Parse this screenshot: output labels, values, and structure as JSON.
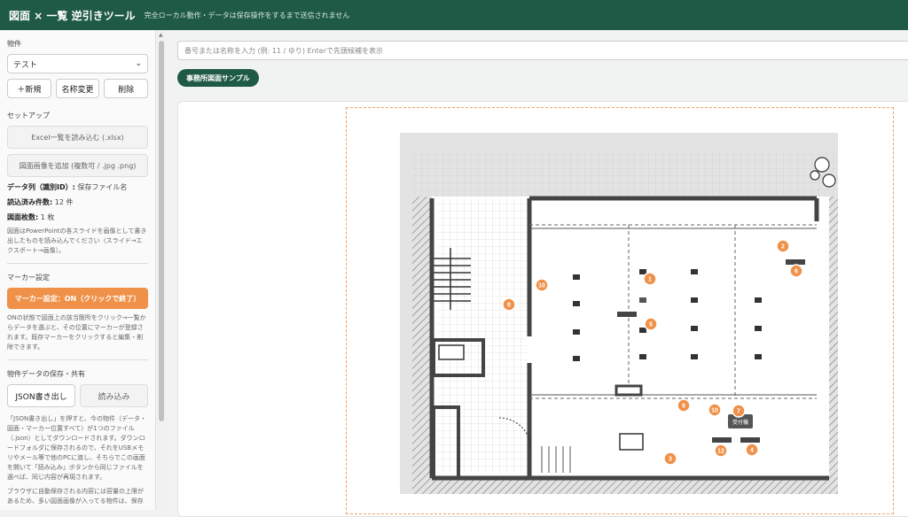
{
  "header": {
    "title": "図面 × 一覧 逆引きツール",
    "subtitle": "完全ローカル動作・データは保存操作をするまで送信されません"
  },
  "sidebar": {
    "property_label": "物件",
    "property_select": "テスト",
    "new_button": "＋新規",
    "rename_button": "名称変更",
    "delete_button": "削除",
    "setup_label": "セットアップ",
    "excel_button": "Excel一覧を読み込む (.xlsx)",
    "image_button": "図面画像を追加 (複数可 / .jpg .png)",
    "data_col_label": "データ列（識別ID）:",
    "data_col_value": "保存ファイル名",
    "loaded_label": "読込済み件数:",
    "loaded_value": "12 件",
    "drawings_label": "図面枚数:",
    "drawings_value": "1 枚",
    "drawings_note": "図面はPowerPointの各スライドを画像として書き出したものを読み込んでください（スライド→エクスポート→画像）。",
    "marker_label": "マーカー設定",
    "marker_button": "マーカー設定：ON（クリックで終了）",
    "marker_note": "ONの状態で図面上の該当箇所をクリック→一覧からデータを選ぶと、その位置にマーカーが登録されます。既存マーカーをクリックすると編集・削除できます。",
    "share_label": "物件データの保存・共有",
    "json_export_button": "JSON書き出し",
    "import_button": "読み込み",
    "share_note": "「JSON書き出し」を押すと、今の物件（データ・図面・マーカー位置すべて）が1つのファイル（.json）としてダウンロードされます。ダウンロードフォルダに保存されるので、それをUSBメモリやメール等で他のPCに渡し、そちらでこの画面を開いて「読み込み」ボタンから同じファイルを選べば、同じ内容が再現されます。",
    "storage_note": "ブラウザに自動保存される内容には容量の上限があるため、多い図面画像が入ってる物件は、保存"
  },
  "main": {
    "search_placeholder": "番号または名称を入力 (例: 11 / ゆり) Enterで先頭候補を表示",
    "drawing_tab": "事務所図面サンプル",
    "reception_label": "受付機"
  },
  "markers": [
    "1",
    "2",
    "3",
    "4",
    "5",
    "6",
    "7",
    "8",
    "9",
    "10",
    "10",
    "12"
  ],
  "colors": {
    "header_bg": "#1f5a46",
    "marker_orange": "#f0914a",
    "accent_orange": "#f0914a"
  }
}
